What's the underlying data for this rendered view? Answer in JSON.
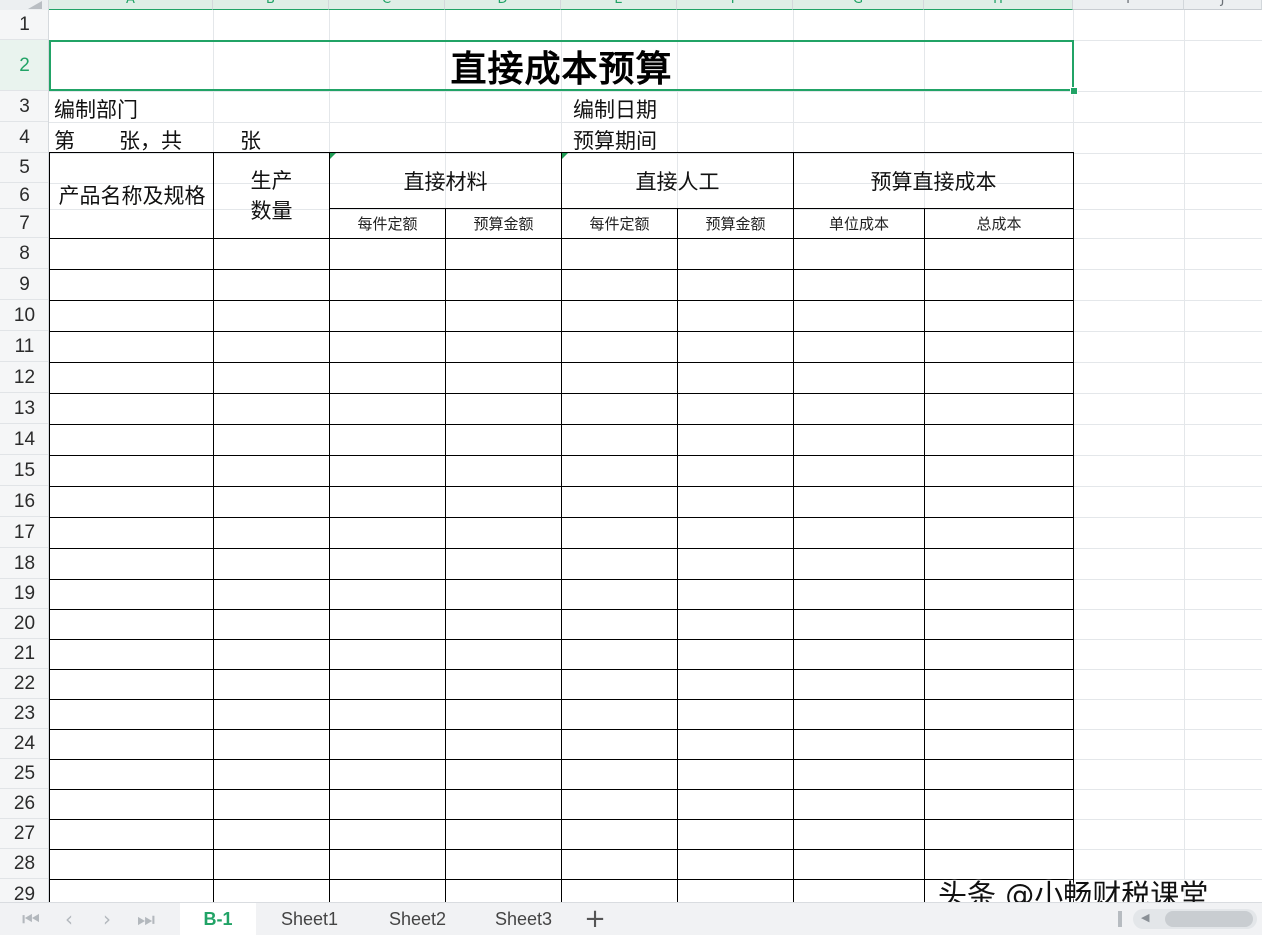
{
  "sheet": {
    "columns": [
      "A",
      "B",
      "C",
      "D",
      "E",
      "F",
      "G",
      "H",
      "I",
      "J"
    ],
    "rows": [
      "1",
      "2",
      "3",
      "4",
      "5",
      "6",
      "7",
      "8",
      "9",
      "10",
      "11",
      "12",
      "13",
      "14",
      "15",
      "16",
      "17",
      "18",
      "19",
      "20",
      "21",
      "22",
      "23",
      "24",
      "25",
      "26",
      "27",
      "28",
      "29"
    ],
    "selected_row": "2",
    "accent_color": "#21a366"
  },
  "form": {
    "title": "直接成本预算",
    "dept_label": "编制部门",
    "date_label": "编制日期",
    "page_left": "第",
    "page_mid": "张，共",
    "page_right": "张",
    "period_label": "预算期间",
    "headers": {
      "product": "产品名称及规格",
      "quantity": "生产数量",
      "materials": "直接材料",
      "labor": "直接人工",
      "budget_cost": "预算直接成本",
      "per_unit_quota_1": "每件定额",
      "budget_amount_1": "预算金额",
      "per_unit_quota_2": "每件定额",
      "budget_amount_2": "预算金额",
      "unit_cost": "单位成本",
      "total_cost": "总成本"
    }
  },
  "tabs": {
    "items": [
      "B-1",
      "Sheet1",
      "Sheet2",
      "Sheet3"
    ],
    "active": "B-1",
    "add": "+"
  },
  "nav": {
    "first": "|<",
    "prev": "<",
    "next": ">",
    "last": ">|"
  },
  "watermark": "头条 @小畅财税课堂"
}
